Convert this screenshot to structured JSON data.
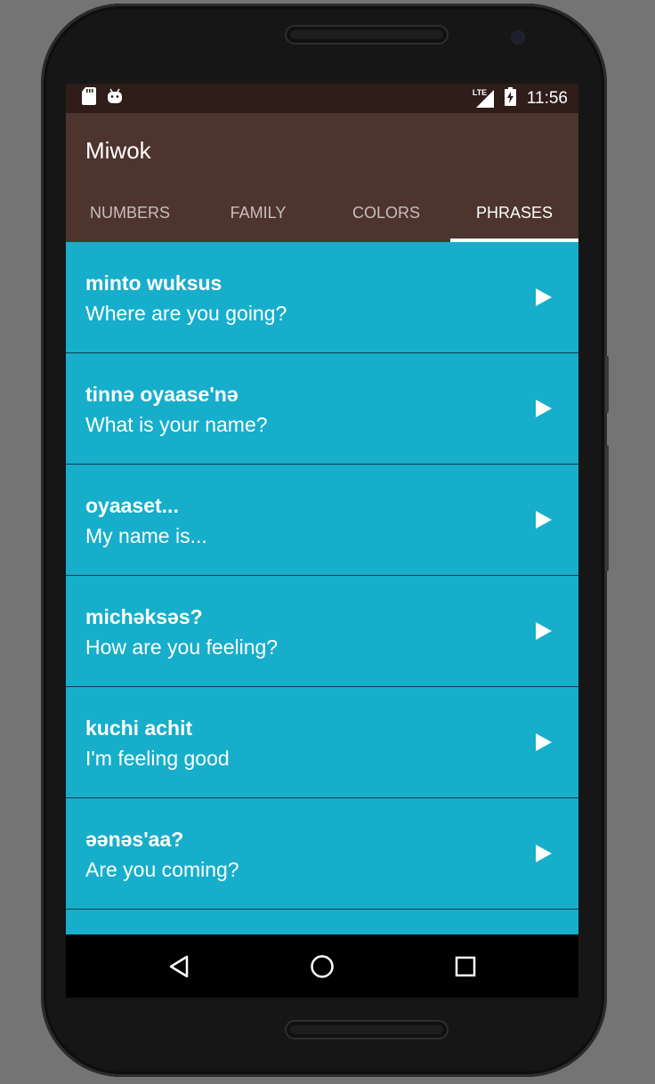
{
  "status_bar": {
    "time": "11:56",
    "network_label": "LTE",
    "icons": [
      "sd-card-icon",
      "android-icon",
      "lte-signal-icon",
      "battery-charging-icon"
    ]
  },
  "app": {
    "title": "Miwok"
  },
  "tabs": [
    {
      "label": "NUMBERS",
      "active": false
    },
    {
      "label": "FAMILY",
      "active": false
    },
    {
      "label": "COLORS",
      "active": false
    },
    {
      "label": "PHRASES",
      "active": true
    }
  ],
  "phrases": [
    {
      "miwok": "minto wuksus",
      "english": "Where are you going?"
    },
    {
      "miwok": "tinnә oyaase'nә",
      "english": "What is your name?"
    },
    {
      "miwok": "oyaaset...",
      "english": "My name is..."
    },
    {
      "miwok": "michәksәs?",
      "english": "How are you feeling?"
    },
    {
      "miwok": "kuchi achit",
      "english": "I'm feeling good"
    },
    {
      "miwok": "әәnәs'aa?",
      "english": "Are you coming?"
    }
  ],
  "nav": {
    "icons": [
      "back-icon",
      "home-icon",
      "recents-icon"
    ]
  },
  "colors": {
    "status_bar": "#2e1d19",
    "app_bar": "#4e342e",
    "list_background": "#16aecb",
    "divider": "#0d3f4a",
    "text": "#ffffff"
  }
}
